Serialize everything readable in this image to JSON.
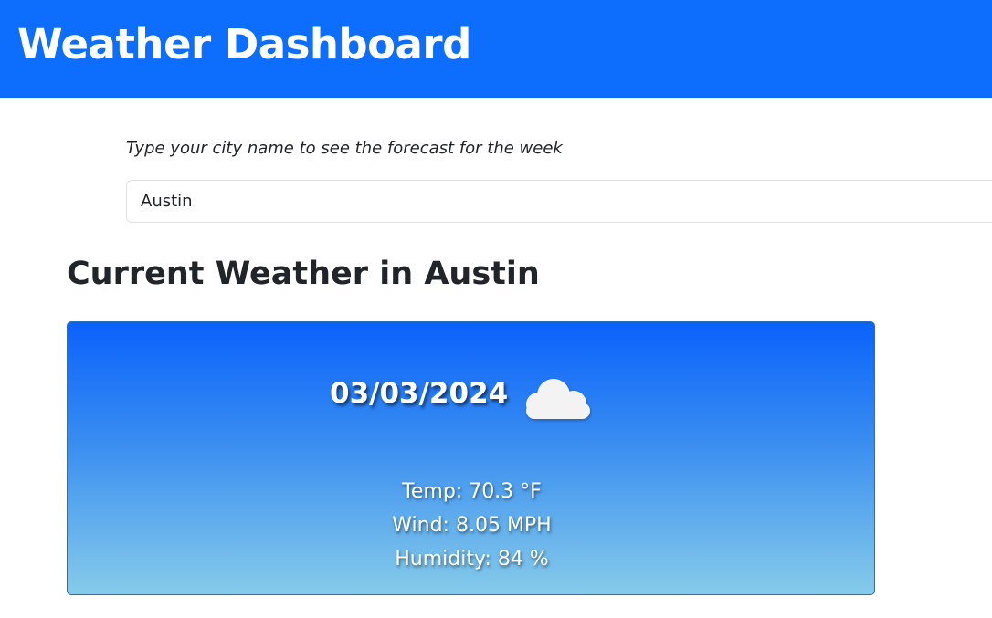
{
  "header": {
    "title": "Weather Dashboard",
    "background_color": "#0d6efd"
  },
  "search": {
    "prompt": "Type your city name to see the forecast for the week",
    "value": "Austin"
  },
  "current": {
    "title": "Current Weather in Austin",
    "card": {
      "date": "03/03/2024",
      "icon": "cloud-icon",
      "temp": "Temp: 70.3 °F",
      "wind": "Wind: 8.05 MPH",
      "humidity": "Humidity: 84 %"
    }
  }
}
